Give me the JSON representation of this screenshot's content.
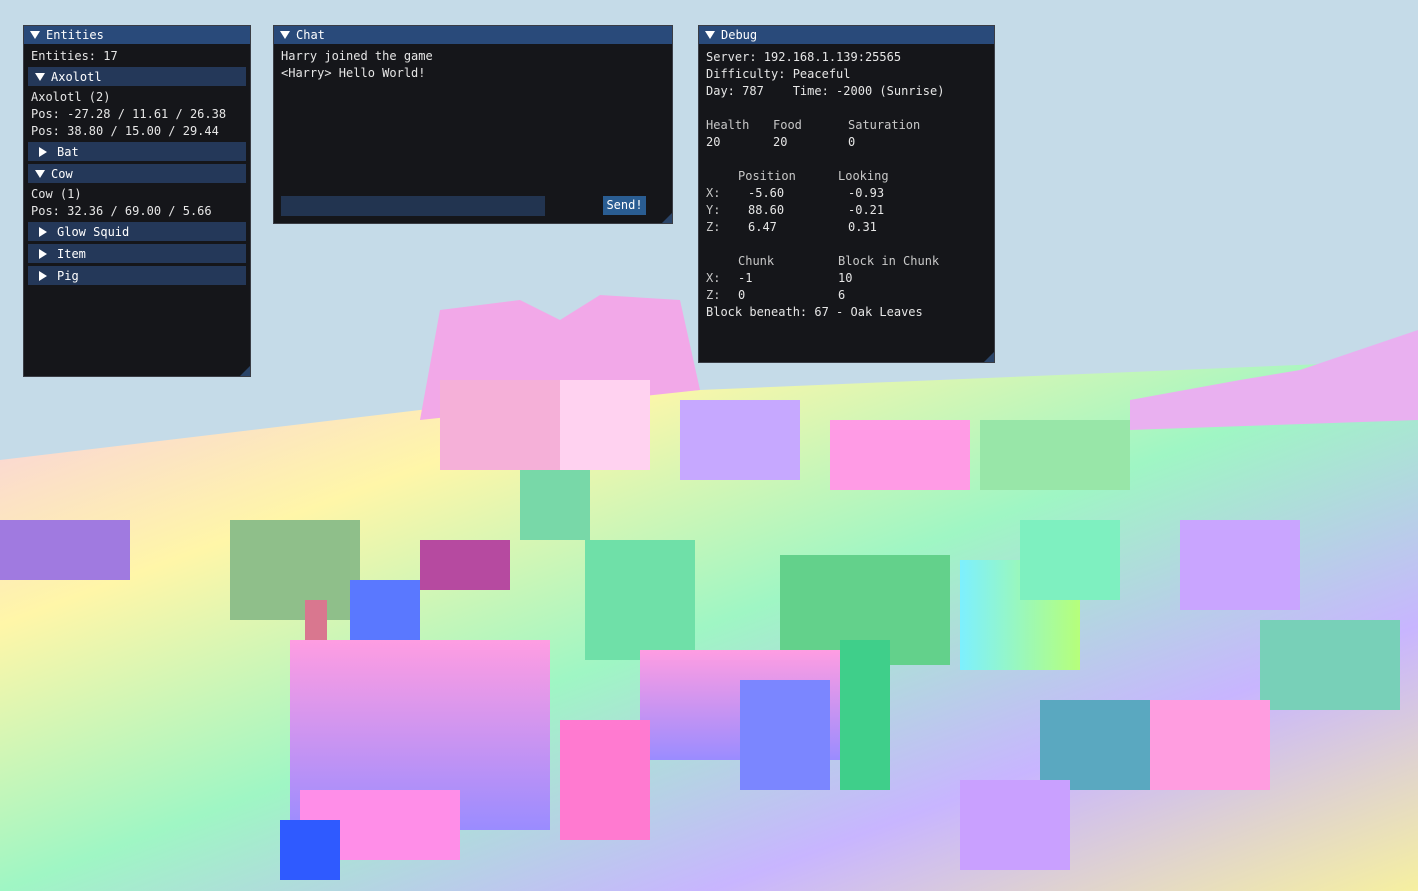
{
  "entities_window": {
    "title": "Entities",
    "count_line": "Entities: 17",
    "groups": [
      {
        "name": "Axolotl",
        "expanded": true,
        "lines": [
          "Axolotl (2)",
          "Pos: -27.28 / 11.61 / 26.38",
          "Pos: 38.80 / 15.00 / 29.44"
        ]
      },
      {
        "name": "Bat",
        "expanded": false,
        "lines": []
      },
      {
        "name": "Cow",
        "expanded": true,
        "lines": [
          "Cow (1)",
          "Pos: 32.36 / 69.00 / 5.66"
        ]
      },
      {
        "name": "Glow Squid",
        "expanded": false,
        "lines": []
      },
      {
        "name": "Item",
        "expanded": false,
        "lines": []
      },
      {
        "name": "Pig",
        "expanded": false,
        "lines": []
      }
    ]
  },
  "chat_window": {
    "title": "Chat",
    "messages": [
      "Harry joined the game",
      "<Harry> Hello World!"
    ],
    "input_value": "",
    "send_label": "Send!"
  },
  "debug_window": {
    "title": "Debug",
    "server": "Server: 192.168.1.139:25565",
    "difficulty": "Difficulty: Peaceful",
    "day_time": "Day: 787    Time: -2000 (Sunrise)",
    "stats_headers": {
      "health": "Health",
      "food": "Food",
      "saturation": "Saturation"
    },
    "stats_values": {
      "health": "20",
      "food": "20",
      "saturation": "0"
    },
    "position_header": "Position",
    "looking_header": "Looking",
    "axes": [
      {
        "label": "X:",
        "position": "-5.60",
        "looking": "-0.93"
      },
      {
        "label": "Y:",
        "position": "88.60",
        "looking": "-0.21"
      },
      {
        "label": "Z:",
        "position": "6.47",
        "looking": "0.31"
      }
    ],
    "chunk_header": "Chunk",
    "block_in_chunk_header": "Block in Chunk",
    "chunk_rows": [
      {
        "label": "X:",
        "chunk": "-1",
        "block": "10"
      },
      {
        "label": "Z:",
        "chunk": "0",
        "block": "6"
      }
    ],
    "block_beneath": "Block beneath: 67 - Oak Leaves"
  },
  "colors": {
    "sky": "#c5dbe8",
    "window_bg": "#15161a",
    "title_bar": "#294a7a",
    "header_bar": "#243859",
    "button": "#2a5d92"
  }
}
